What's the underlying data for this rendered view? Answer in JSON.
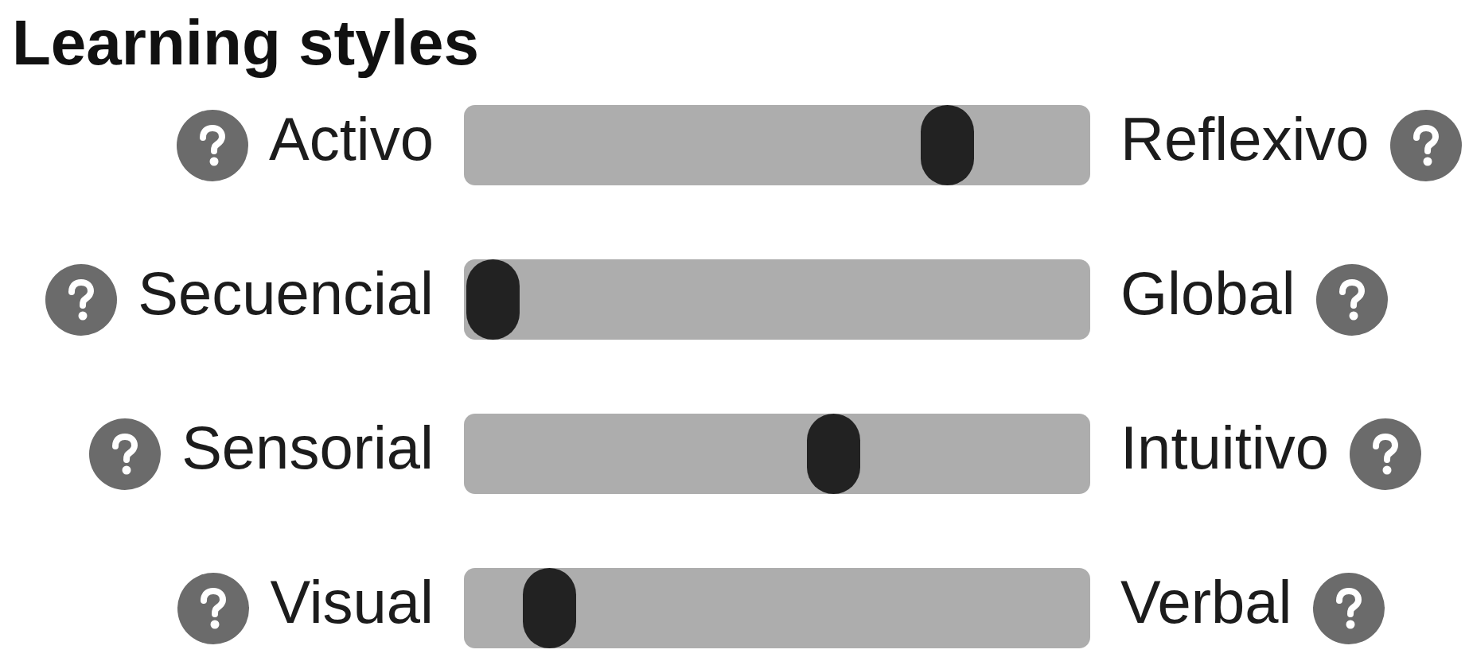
{
  "title": "Learning styles",
  "sliders": [
    {
      "left_label": "Activo",
      "right_label": "Reflexivo",
      "level": 0.8
    },
    {
      "left_label": "Secuencial",
      "right_label": "Global",
      "level": 0
    },
    {
      "left_label": "Sensorial",
      "right_label": "Intuitivo",
      "level": 0.6
    },
    {
      "left_label": "Visual",
      "right_label": "Verbal",
      "level": 0.1
    }
  ]
}
